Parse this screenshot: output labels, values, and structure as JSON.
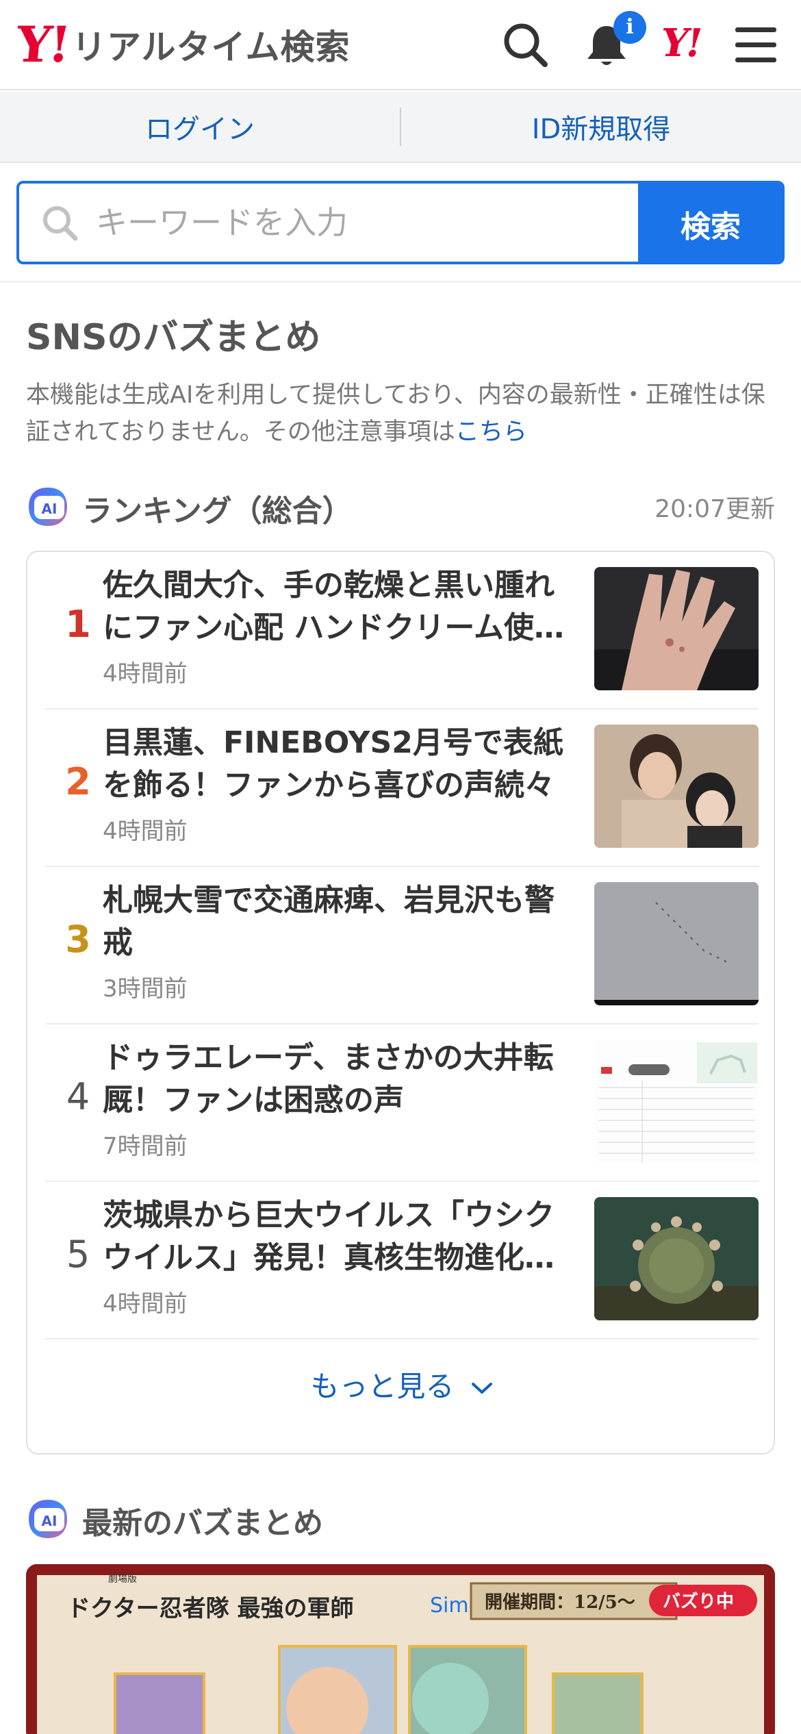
{
  "header": {
    "logo_mark": "Y!",
    "logo_text": "リアルタイム検索",
    "notification_badge": "i",
    "yj_mark": "Y!"
  },
  "login_bar": {
    "login_label": "ログイン",
    "signup_label": "ID新規取得"
  },
  "search": {
    "placeholder": "キーワードを入力",
    "button_label": "検索"
  },
  "sns": {
    "title": "SNSのバズまとめ",
    "disclaimer": "本機能は生成AIを利用して提供しており、内容の最新性・正確性は保証されておりません。その他注意事項は",
    "disclaimer_link": "こちら"
  },
  "ranking": {
    "ai_label": "AI",
    "title": "ランキング（総合）",
    "updated": "20:07更新",
    "items": [
      {
        "rank": "1",
        "title": "佐久間大介、手の乾燥と黒い腫れにファン心配 ハンドクリーム使用を報告",
        "time": "4時間前",
        "rank_color": "#d0332a"
      },
      {
        "rank": "2",
        "title": "目黒蓮、FINEBOYS2月号で表紙を飾る！ファンから喜びの声続々",
        "time": "4時間前",
        "rank_color": "#e8602a"
      },
      {
        "rank": "3",
        "title": "札幌大雪で交通麻痺、岩見沢も警戒",
        "time": "3時間前",
        "rank_color": "#c8921a"
      },
      {
        "rank": "4",
        "title": "ドゥラエレーデ、まさかの大井転厩！ファンは困惑の声",
        "time": "7時間前",
        "rank_color": "#555555"
      },
      {
        "rank": "5",
        "title": "茨城県から巨大ウイルス「ウシクウイルス」発見！真核生物進化の謎に迫る",
        "time": "4時間前",
        "rank_color": "#555555"
      }
    ],
    "more_label": "もっと見る"
  },
  "latest": {
    "ai_label": "AI",
    "title": "最新のバズまとめ",
    "banner_text_1": "劇場版",
    "banner_text_2": "ドクター忍者隊 最強の軍師",
    "banner_partner": "Simeji",
    "banner_period": "開催期間：12/5〜",
    "banner_tag": "バズり中"
  }
}
